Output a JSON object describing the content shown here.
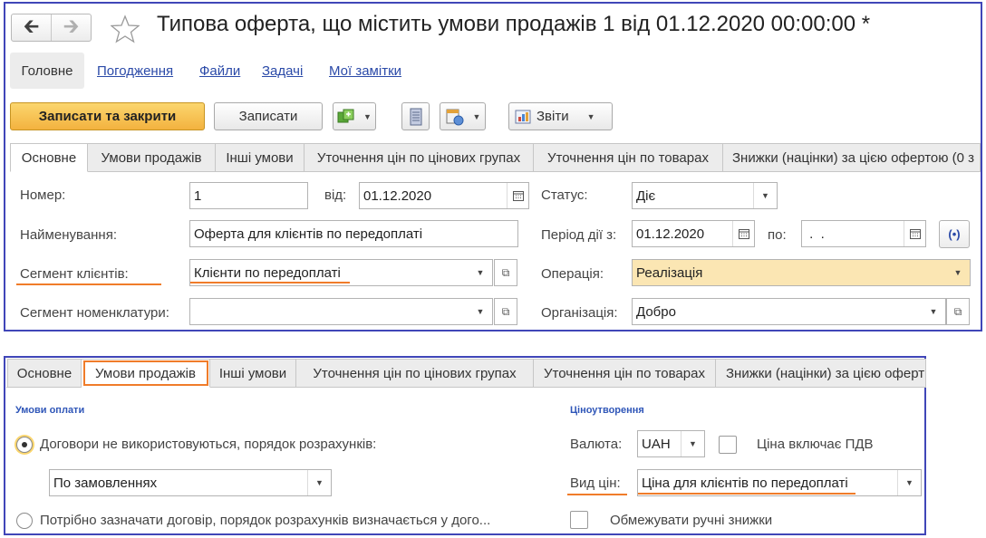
{
  "window": {
    "title": "Типова оферта, що містить умови продажів 1 від 01.12.2020 00:00:00 *",
    "back_icon": "arrow-left-icon",
    "forward_icon": "arrow-right-icon",
    "favorite_icon": "star-icon"
  },
  "nav": {
    "main": "Головне",
    "links": [
      "Погодження",
      "Файли",
      "Задачі",
      "Мої замітки"
    ]
  },
  "toolbar": {
    "save_close": "Записати та закрити",
    "save": "Записати",
    "reports": "Звіти",
    "icons": [
      "create-based-on-icon",
      "document-list-icon",
      "print-icon",
      "reports-icon"
    ]
  },
  "top_tabs": [
    "Основне",
    "Умови продажів",
    "Інші умови",
    "Уточнення цін по цінових групах",
    "Уточнення цін по товарах",
    "Знижки (націнки) за цією офертою (0 з"
  ],
  "main_form": {
    "number_label": "Номер:",
    "number_value": "1",
    "date_label": "від:",
    "date_value": "01.12.2020",
    "status_label": "Статус:",
    "status_value": "Діє",
    "name_label": "Найменування:",
    "name_value": "Оферта для клієнтів по передоплаті",
    "period_label": "Період дії з:",
    "period_from": "01.12.2020",
    "period_to_label": "по:",
    "period_to": " .  .",
    "segment_label": "Сегмент клієнтів:",
    "segment_value": "Клієнти по передоплаті",
    "operation_label": "Операція:",
    "operation_value": "Реалізація",
    "nomenclature_label": "Сегмент номенклатури:",
    "nomenclature_value": "",
    "org_label": "Організація:",
    "org_value": "Добро"
  },
  "bottom_tabs": [
    "Основне",
    "Умови продажів",
    "Інші умови",
    "Уточнення цін по цінових групах",
    "Уточнення цін по товарах",
    "Знижки (націнки) за цією оферт"
  ],
  "sales_terms": {
    "payment_section": "Умови оплати",
    "radio1": "Договори не використовуються, порядок розрахунків:",
    "payment_order": "По замовленнях",
    "radio2": "Потрібно зазначати договір, порядок розрахунків визначається у дого...",
    "pricing_section": "Ціноутворення",
    "currency_label": "Валюта:",
    "currency_value": "UAH",
    "vat_label": "Ціна включає ПДВ",
    "price_type_label": "Вид цін:",
    "price_type_value": "Ціна для клієнтів по передоплаті",
    "limit_discounts_label": "Обмежувати ручні знижки"
  },
  "colors": {
    "frame": "#4046b8",
    "highlight": "#f07c2a",
    "primary_button": "#f3b23f",
    "section_title": "#2f56b8",
    "link": "#2b4aa8",
    "operation_fill": "#fbe6b3"
  }
}
